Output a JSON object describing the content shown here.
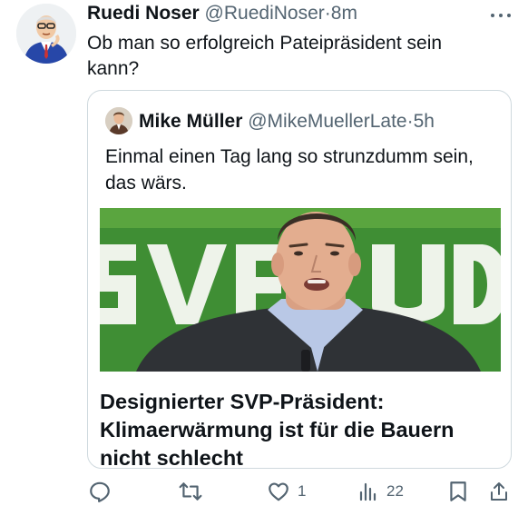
{
  "tweet": {
    "author_name": "Ruedi Noser",
    "author_handle": "@RuediNoser",
    "separator": "·",
    "time": "8m",
    "text": "Ob man so erfolgreich Pateipräsident sein kann?",
    "more_icon": "more-icon"
  },
  "quoted": {
    "author_name": "Mike Müller",
    "author_handle": "@MikeMuellerLate",
    "separator": "·",
    "time": "5h",
    "text": "Einmal einen Tag lang so strunzdumm sein, das wärs.",
    "headline": "Designierter SVP-Präsident: Klimaerwärmung ist für die Bauern nicht schlecht",
    "image_backdrop_text": "SVP UDC"
  },
  "actions": {
    "reply_icon": "reply-icon",
    "retweet_icon": "retweet-icon",
    "like_icon": "like-icon",
    "like_count": "1",
    "views_icon": "views-icon",
    "views_count": "22",
    "bookmark_icon": "bookmark-icon",
    "share_icon": "share-icon"
  },
  "colors": {
    "text": "#0f1419",
    "secondary": "#536471",
    "border": "#cfd9de",
    "svp_green": "#3f8e34"
  }
}
